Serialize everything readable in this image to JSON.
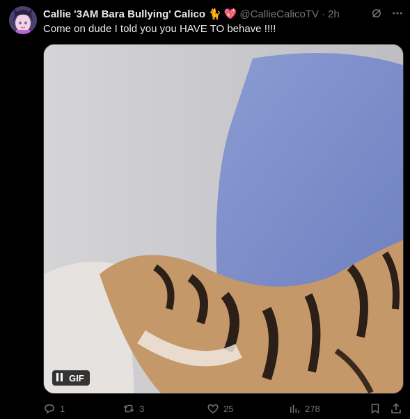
{
  "tweet": {
    "display_name": "Callie '3AM Bara Bullying' Calico",
    "emojis": [
      "🐈",
      "💖"
    ],
    "handle": "@CallieCalicoTV",
    "separator": "·",
    "time": "2h",
    "text": "Come on dude I told you you HAVE TO behave !!!!",
    "media": {
      "badge": "GIF",
      "state": "playing"
    }
  },
  "actions": {
    "replies": "1",
    "retweets": "3",
    "likes": "25",
    "views": "278"
  },
  "colors": {
    "muted": "#71767b",
    "text": "#e7e9ea",
    "background": "#000000"
  }
}
